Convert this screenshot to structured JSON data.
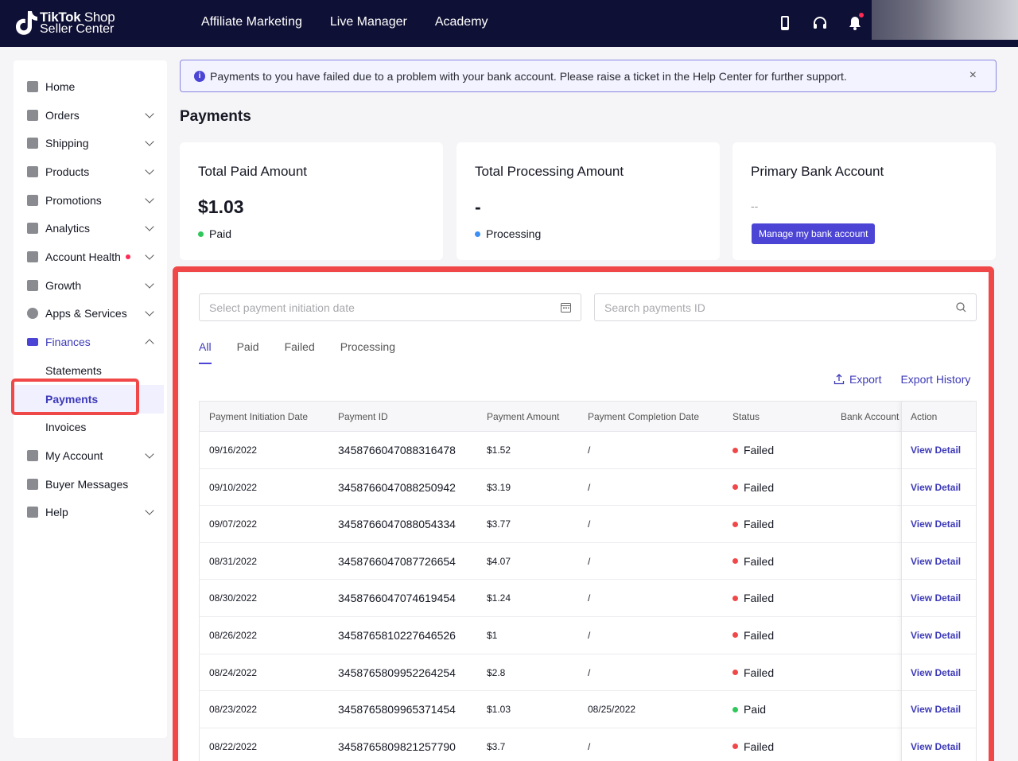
{
  "brand": {
    "line1_bold": "TikTok",
    "line1_rest": " Shop",
    "line2": "Seller Center"
  },
  "topnav": [
    "Affiliate Marketing",
    "Live Manager",
    "Academy"
  ],
  "sidebar": {
    "items": [
      {
        "label": "Home",
        "icon": "home-icon"
      },
      {
        "label": "Orders",
        "icon": "orders-icon"
      },
      {
        "label": "Shipping",
        "icon": "truck-icon"
      },
      {
        "label": "Products",
        "icon": "bag-icon"
      },
      {
        "label": "Promotions",
        "icon": "megaphone-icon"
      },
      {
        "label": "Analytics",
        "icon": "bar-chart-icon"
      },
      {
        "label": "Account Health",
        "icon": "trophy-icon"
      },
      {
        "label": "Growth",
        "icon": "medal-icon"
      },
      {
        "label": "Apps & Services",
        "icon": "globe-icon"
      },
      {
        "label": "Finances",
        "icon": "card-icon"
      },
      {
        "label": "My Account",
        "icon": "user-icon"
      },
      {
        "label": "Buyer Messages",
        "icon": "chat-icon"
      },
      {
        "label": "Help",
        "icon": "help-icon"
      }
    ],
    "finance_sub": [
      "Statements",
      "Payments",
      "Invoices"
    ]
  },
  "alert": {
    "text": "Payments to you have failed due to a problem with your bank account. Please raise a ticket in the Help Center for further support.",
    "close": "×"
  },
  "page_title": "Payments",
  "cards": {
    "paid": {
      "title": "Total Paid Amount",
      "value": "$1.03",
      "status": "Paid"
    },
    "processing": {
      "title": "Total Processing Amount",
      "value": "-",
      "status": "Processing"
    },
    "bank": {
      "title": "Primary Bank Account",
      "value": "--",
      "button": "Manage my bank account"
    }
  },
  "filters": {
    "date_placeholder": "Select payment initiation date",
    "search_placeholder": "Search payments ID"
  },
  "tabs": [
    "All",
    "Paid",
    "Failed",
    "Processing"
  ],
  "export": {
    "export": "Export",
    "history": "Export History"
  },
  "table": {
    "headers": [
      "Payment Initiation Date",
      "Payment ID",
      "Payment Amount",
      "Payment Completion Date",
      "Status",
      "Bank Account",
      "Action"
    ],
    "rows": [
      {
        "date": "09/16/2022",
        "id": "3458766047088316478",
        "amount": "$1.52",
        "completion": "/",
        "status": "Failed",
        "action": "View Detail"
      },
      {
        "date": "09/10/2022",
        "id": "3458766047088250942",
        "amount": "$3.19",
        "completion": "/",
        "status": "Failed",
        "action": "View Detail"
      },
      {
        "date": "09/07/2022",
        "id": "3458766047088054334",
        "amount": "$3.77",
        "completion": "/",
        "status": "Failed",
        "action": "View Detail"
      },
      {
        "date": "08/31/2022",
        "id": "3458766047087726654",
        "amount": "$4.07",
        "completion": "/",
        "status": "Failed",
        "action": "View Detail"
      },
      {
        "date": "08/30/2022",
        "id": "3458766047074619454",
        "amount": "$1.24",
        "completion": "/",
        "status": "Failed",
        "action": "View Detail"
      },
      {
        "date": "08/26/2022",
        "id": "3458765810227646526",
        "amount": "$1",
        "completion": "/",
        "status": "Failed",
        "action": "View Detail"
      },
      {
        "date": "08/24/2022",
        "id": "3458765809952264254",
        "amount": "$2.8",
        "completion": "/",
        "status": "Failed",
        "action": "View Detail"
      },
      {
        "date": "08/23/2022",
        "id": "3458765809965371454",
        "amount": "$1.03",
        "completion": "08/25/2022",
        "status": "Paid",
        "action": "View Detail"
      },
      {
        "date": "08/22/2022",
        "id": "3458765809821257790",
        "amount": "$3.7",
        "completion": "/",
        "status": "Failed",
        "action": "View Detail"
      }
    ]
  },
  "colors": {
    "failed": "#f04848",
    "paid": "#2fc75a",
    "processing": "#3b8ff5",
    "accent": "#4b44d4"
  }
}
